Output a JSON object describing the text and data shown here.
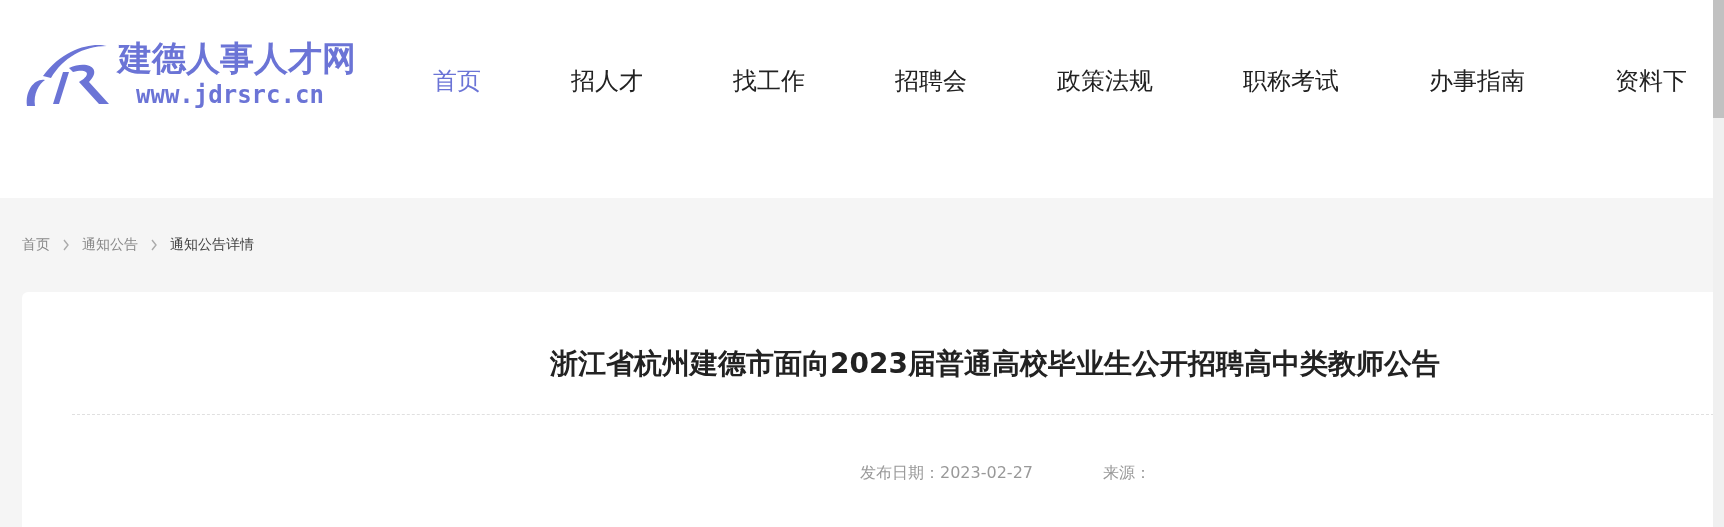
{
  "logo": {
    "title": "建德人事人才网",
    "url": "www.jdrsrc.cn"
  },
  "nav": [
    {
      "label": "首页",
      "selected": true
    },
    {
      "label": "招人才",
      "selected": false
    },
    {
      "label": "找工作",
      "selected": false
    },
    {
      "label": "招聘会",
      "selected": false
    },
    {
      "label": "政策法规",
      "selected": false
    },
    {
      "label": "职称考试",
      "selected": false
    },
    {
      "label": "办事指南",
      "selected": false
    },
    {
      "label": "资料下",
      "selected": false
    }
  ],
  "breadcrumb": [
    "首页",
    "通知公告",
    "通知公告详情"
  ],
  "article": {
    "title": "浙江省杭州建德市面向2023届普通高校毕业生公开招聘高中类教师公告",
    "date": "发布日期：2023-02-27",
    "source": "来源："
  }
}
